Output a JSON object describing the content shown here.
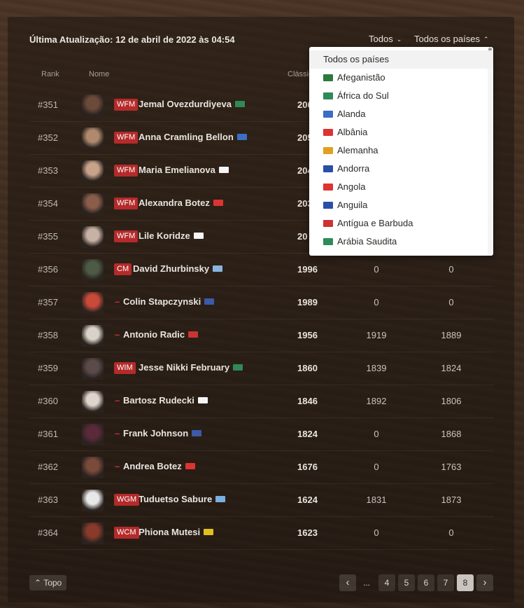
{
  "header": {
    "last_update": "Última Atualização: 12 de abril de 2022 às 04:54",
    "filter_type": "Todos",
    "filter_country": "Todos os países"
  },
  "table": {
    "col_rank": "Rank",
    "col_name": "Nome",
    "col_classic": "Clássic"
  },
  "rows": [
    {
      "rank": "#351",
      "title": "WFM",
      "name": "Jemal Ovezdurdiyeva",
      "flag_color": "#2e8b57",
      "rating": "206",
      "rapid": "",
      "blitz": ""
    },
    {
      "rank": "#352",
      "title": "WFM",
      "name": "Anna Cramling Bellon",
      "flag_color": "#3a6fc4",
      "rating": "205",
      "rapid": "",
      "blitz": ""
    },
    {
      "rank": "#353",
      "title": "WFM",
      "name": "Maria Emelianova",
      "flag_color": "#f5f5f5",
      "rating": "204",
      "rapid": "",
      "blitz": ""
    },
    {
      "rank": "#354",
      "title": "WFM",
      "name": "Alexandra Botez",
      "flag_color": "#d33",
      "rating": "203",
      "rapid": "",
      "blitz": ""
    },
    {
      "rank": "#355",
      "title": "WFM",
      "name": "Lile Koridze",
      "flag_color": "#f5f5f5",
      "rating": "20",
      "rapid": "",
      "blitz": ""
    },
    {
      "rank": "#356",
      "title": "CM",
      "name": "David Zhurbinsky",
      "flag_color": "#8ab4e0",
      "rating": "1996",
      "rapid": "0",
      "blitz": "0"
    },
    {
      "rank": "#357",
      "title": "",
      "name": "Colin Stapczynski",
      "flag_color": "#3c5aa8",
      "rating": "1989",
      "rapid": "0",
      "blitz": "0"
    },
    {
      "rank": "#358",
      "title": "",
      "name": "Antonio Radic",
      "flag_color": "#c33",
      "rating": "1956",
      "rapid": "1919",
      "blitz": "1889"
    },
    {
      "rank": "#359",
      "title": "WIM",
      "name": "Jesse Nikki February",
      "flag_color": "#2e8b57",
      "rating": "1860",
      "rapid": "1839",
      "blitz": "1824"
    },
    {
      "rank": "#360",
      "title": "",
      "name": "Bartosz Rudecki",
      "flag_color": "#f5f5f5",
      "rating": "1846",
      "rapid": "1892",
      "blitz": "1806"
    },
    {
      "rank": "#361",
      "title": "",
      "name": "Frank Johnson",
      "flag_color": "#3c5aa8",
      "rating": "1824",
      "rapid": "0",
      "blitz": "1868"
    },
    {
      "rank": "#362",
      "title": "",
      "name": "Andrea Botez",
      "flag_color": "#d33",
      "rating": "1676",
      "rapid": "0",
      "blitz": "1763"
    },
    {
      "rank": "#363",
      "title": "WGM",
      "name": "Tuduetso Sabure",
      "flag_color": "#7ab0e0",
      "rating": "1624",
      "rapid": "1831",
      "blitz": "1873"
    },
    {
      "rank": "#364",
      "title": "WCM",
      "name": "Phiona Mutesi",
      "flag_color": "#e0c020",
      "rating": "1623",
      "rapid": "0",
      "blitz": "0"
    }
  ],
  "country_dropdown": {
    "options": [
      {
        "label": "Todos os países",
        "flag": ""
      },
      {
        "label": "Afeganistão",
        "flag": "#2b7a3b"
      },
      {
        "label": "África do Sul",
        "flag": "#2e8b57"
      },
      {
        "label": "Alanda",
        "flag": "#3b6ec4"
      },
      {
        "label": "Albânia",
        "flag": "#d33"
      },
      {
        "label": "Alemanha",
        "flag": "#e0a020"
      },
      {
        "label": "Andorra",
        "flag": "#2a4fa8"
      },
      {
        "label": "Angola",
        "flag": "#d33"
      },
      {
        "label": "Anguila",
        "flag": "#2a4fa8"
      },
      {
        "label": "Antígua e Barbuda",
        "flag": "#c33"
      },
      {
        "label": "Arábia Saudita",
        "flag": "#2e8b57"
      }
    ]
  },
  "footer": {
    "top_label": "Topo",
    "pages": [
      "4",
      "5",
      "6",
      "7",
      "8"
    ],
    "ellipsis": "...",
    "current_page": "8"
  },
  "colors": {
    "title_badge": "#b52a2a",
    "background_wood": "#3b2a1d"
  }
}
